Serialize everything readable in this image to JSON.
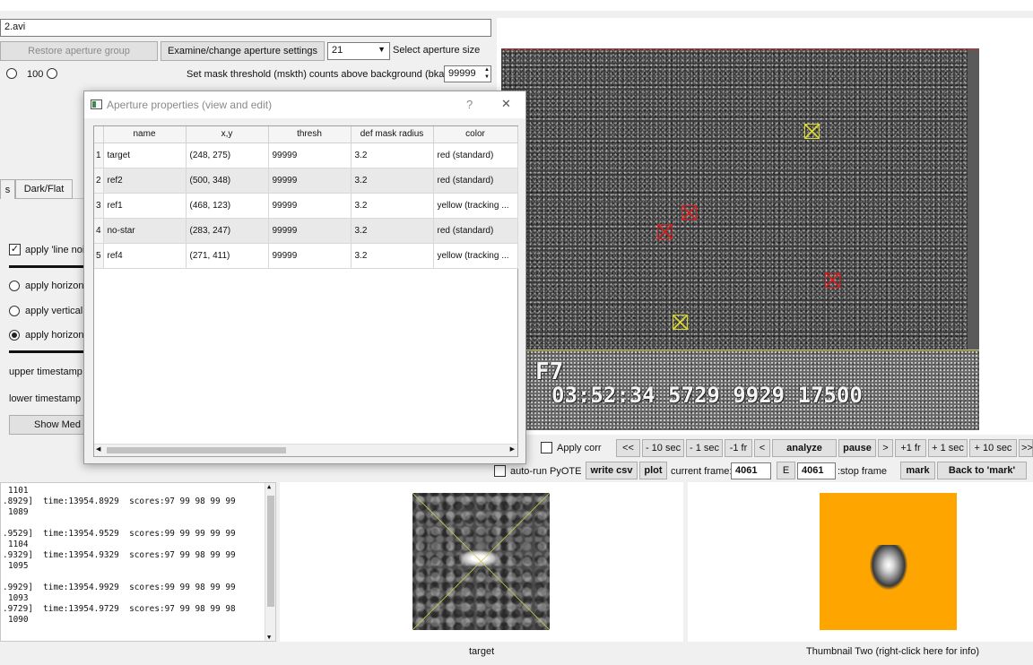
{
  "file_path": "2.avi",
  "toolbar": {
    "restore_aperture_group": "Restore aperture group",
    "examine_change_aperture_settings": "Examine/change aperture settings",
    "aperture_size_value": "21",
    "select_aperture_size": "Select aperture size",
    "radio_100": "100",
    "mask_threshold_label": "Set mask threshold (mskth) counts above background (bkavg)",
    "mask_threshold_value": "99999"
  },
  "left_panel": {
    "tab_partial": "s",
    "tab_dark_flat": "Dark/Flat",
    "apply_line_noise": "apply 'line nois",
    "apply_horizontal_1": "apply horizont",
    "apply_vertically": "apply vertically",
    "apply_horizontal_2": "apply horizont",
    "upper_timestamp": "upper timestamp li",
    "lower_timestamp": "lower timestamp li",
    "show_med": "Show Med"
  },
  "dialog": {
    "title": "Aperture properties (view and edit)",
    "help": "?",
    "close": "✕",
    "columns": [
      "name",
      "x,y",
      "thresh",
      "def mask radius",
      "color"
    ],
    "rows": [
      {
        "n": "1",
        "name": "target",
        "xy": "(248, 275)",
        "thresh": "99999",
        "radius": "3.2",
        "color": "red (standard)"
      },
      {
        "n": "2",
        "name": "ref2",
        "xy": "(500, 348)",
        "thresh": "99999",
        "radius": "3.2",
        "color": "red (standard)"
      },
      {
        "n": "3",
        "name": "ref1",
        "xy": "(468, 123)",
        "thresh": "99999",
        "radius": "3.2",
        "color": "yellow (tracking ..."
      },
      {
        "n": "4",
        "name": "no-star",
        "xy": "(283, 247)",
        "thresh": "99999",
        "radius": "3.2",
        "color": "red (standard)"
      },
      {
        "n": "5",
        "name": "ref4",
        "xy": "(271, 411)",
        "thresh": "99999",
        "radius": "3.2",
        "color": "yellow (tracking ..."
      }
    ]
  },
  "video": {
    "stamp_top": "F7",
    "stamp_bottom": "03:52:34 5729 9929 17500"
  },
  "controls": {
    "apply_corr": "Apply corr",
    "back_first": "<<",
    "minus_10_sec": "- 10 sec",
    "minus_1_sec": "- 1 sec",
    "minus_1_fr": "-1 fr",
    "back_one": "<",
    "analyze": "analyze",
    "pause": "pause",
    "forward_one": ">",
    "plus_1_fr": "+1 fr",
    "plus_1_sec": "+ 1 sec",
    "plus_10_sec": "+ 10 sec",
    "forward_last": ">>",
    "auto_run_pyote": "auto-run PyOTE",
    "write_csv": "write csv",
    "plot": "plot",
    "current_frame_label": "current frame:",
    "current_frame_value": "4061",
    "e_button": "E",
    "stop_frame_value": "4061",
    "stop_frame_label": ":stop frame",
    "mark": "mark",
    "back_to_mark": "Back to 'mark'"
  },
  "log": [
    "1101",
    ".8929]  time:13954.8929  scores:97 99 98 99 99",
    "1089",
    "",
    ".9529]  time:13954.9529  scores:99 99 99 99 99",
    "1104",
    ".9329]  time:13954.9329  scores:97 99 98 99 99",
    "1095",
    "",
    ".9929]  time:13954.9929  scores:99 99 98 99 99",
    "1093",
    ".9729]  time:13954.9729  scores:97 99 98 99 98",
    "1090"
  ],
  "thumbnails": {
    "thumb_one_label": "target",
    "thumb_two_label": "Thumbnail Two (right-click here for info)",
    "thumb_two_bg": "#ffa500"
  }
}
